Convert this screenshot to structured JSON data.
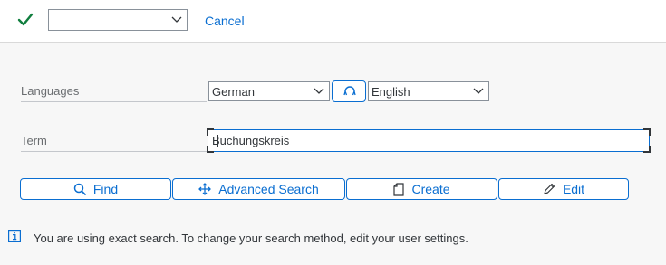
{
  "toolbar": {
    "confirm_icon": "checkmark-icon",
    "select_value": "",
    "cancel_label": "Cancel"
  },
  "form": {
    "languages_label": "Languages",
    "source_language": "German",
    "target_language": "English",
    "swap_icon": "swap-languages-icon",
    "term_label": "Term",
    "term_value": "Buchungskreis"
  },
  "actions": {
    "find_label": "Find",
    "advanced_search_label": "Advanced Search",
    "create_label": "Create",
    "edit_label": "Edit"
  },
  "info": {
    "icon": "info-icon",
    "message": "You are using exact search. To change your search method, edit your user settings."
  },
  "colors": {
    "accent": "#0a6ed1",
    "confirm_green": "#107e3e",
    "background": "#f7f7f7"
  }
}
